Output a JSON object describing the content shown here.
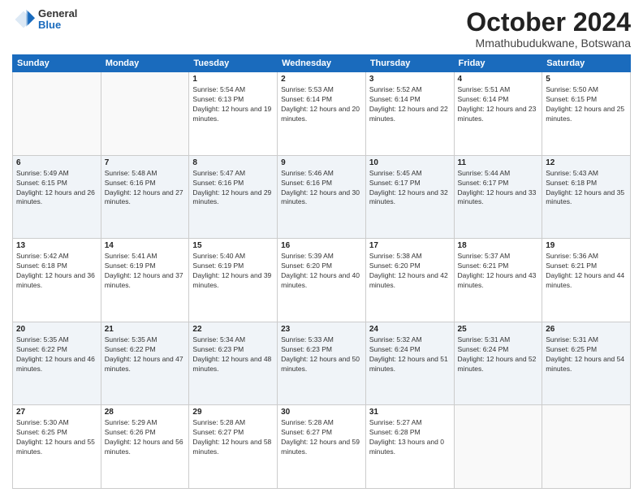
{
  "logo": {
    "general": "General",
    "blue": "Blue"
  },
  "header": {
    "month": "October 2024",
    "location": "Mmathubudukwane, Botswana"
  },
  "weekdays": [
    "Sunday",
    "Monday",
    "Tuesday",
    "Wednesday",
    "Thursday",
    "Friday",
    "Saturday"
  ],
  "weeks": [
    [
      {
        "day": "",
        "sunrise": "",
        "sunset": "",
        "daylight": ""
      },
      {
        "day": "",
        "sunrise": "",
        "sunset": "",
        "daylight": ""
      },
      {
        "day": "1",
        "sunrise": "Sunrise: 5:54 AM",
        "sunset": "Sunset: 6:13 PM",
        "daylight": "Daylight: 12 hours and 19 minutes."
      },
      {
        "day": "2",
        "sunrise": "Sunrise: 5:53 AM",
        "sunset": "Sunset: 6:14 PM",
        "daylight": "Daylight: 12 hours and 20 minutes."
      },
      {
        "day": "3",
        "sunrise": "Sunrise: 5:52 AM",
        "sunset": "Sunset: 6:14 PM",
        "daylight": "Daylight: 12 hours and 22 minutes."
      },
      {
        "day": "4",
        "sunrise": "Sunrise: 5:51 AM",
        "sunset": "Sunset: 6:14 PM",
        "daylight": "Daylight: 12 hours and 23 minutes."
      },
      {
        "day": "5",
        "sunrise": "Sunrise: 5:50 AM",
        "sunset": "Sunset: 6:15 PM",
        "daylight": "Daylight: 12 hours and 25 minutes."
      }
    ],
    [
      {
        "day": "6",
        "sunrise": "Sunrise: 5:49 AM",
        "sunset": "Sunset: 6:15 PM",
        "daylight": "Daylight: 12 hours and 26 minutes."
      },
      {
        "day": "7",
        "sunrise": "Sunrise: 5:48 AM",
        "sunset": "Sunset: 6:16 PM",
        "daylight": "Daylight: 12 hours and 27 minutes."
      },
      {
        "day": "8",
        "sunrise": "Sunrise: 5:47 AM",
        "sunset": "Sunset: 6:16 PM",
        "daylight": "Daylight: 12 hours and 29 minutes."
      },
      {
        "day": "9",
        "sunrise": "Sunrise: 5:46 AM",
        "sunset": "Sunset: 6:16 PM",
        "daylight": "Daylight: 12 hours and 30 minutes."
      },
      {
        "day": "10",
        "sunrise": "Sunrise: 5:45 AM",
        "sunset": "Sunset: 6:17 PM",
        "daylight": "Daylight: 12 hours and 32 minutes."
      },
      {
        "day": "11",
        "sunrise": "Sunrise: 5:44 AM",
        "sunset": "Sunset: 6:17 PM",
        "daylight": "Daylight: 12 hours and 33 minutes."
      },
      {
        "day": "12",
        "sunrise": "Sunrise: 5:43 AM",
        "sunset": "Sunset: 6:18 PM",
        "daylight": "Daylight: 12 hours and 35 minutes."
      }
    ],
    [
      {
        "day": "13",
        "sunrise": "Sunrise: 5:42 AM",
        "sunset": "Sunset: 6:18 PM",
        "daylight": "Daylight: 12 hours and 36 minutes."
      },
      {
        "day": "14",
        "sunrise": "Sunrise: 5:41 AM",
        "sunset": "Sunset: 6:19 PM",
        "daylight": "Daylight: 12 hours and 37 minutes."
      },
      {
        "day": "15",
        "sunrise": "Sunrise: 5:40 AM",
        "sunset": "Sunset: 6:19 PM",
        "daylight": "Daylight: 12 hours and 39 minutes."
      },
      {
        "day": "16",
        "sunrise": "Sunrise: 5:39 AM",
        "sunset": "Sunset: 6:20 PM",
        "daylight": "Daylight: 12 hours and 40 minutes."
      },
      {
        "day": "17",
        "sunrise": "Sunrise: 5:38 AM",
        "sunset": "Sunset: 6:20 PM",
        "daylight": "Daylight: 12 hours and 42 minutes."
      },
      {
        "day": "18",
        "sunrise": "Sunrise: 5:37 AM",
        "sunset": "Sunset: 6:21 PM",
        "daylight": "Daylight: 12 hours and 43 minutes."
      },
      {
        "day": "19",
        "sunrise": "Sunrise: 5:36 AM",
        "sunset": "Sunset: 6:21 PM",
        "daylight": "Daylight: 12 hours and 44 minutes."
      }
    ],
    [
      {
        "day": "20",
        "sunrise": "Sunrise: 5:35 AM",
        "sunset": "Sunset: 6:22 PM",
        "daylight": "Daylight: 12 hours and 46 minutes."
      },
      {
        "day": "21",
        "sunrise": "Sunrise: 5:35 AM",
        "sunset": "Sunset: 6:22 PM",
        "daylight": "Daylight: 12 hours and 47 minutes."
      },
      {
        "day": "22",
        "sunrise": "Sunrise: 5:34 AM",
        "sunset": "Sunset: 6:23 PM",
        "daylight": "Daylight: 12 hours and 48 minutes."
      },
      {
        "day": "23",
        "sunrise": "Sunrise: 5:33 AM",
        "sunset": "Sunset: 6:23 PM",
        "daylight": "Daylight: 12 hours and 50 minutes."
      },
      {
        "day": "24",
        "sunrise": "Sunrise: 5:32 AM",
        "sunset": "Sunset: 6:24 PM",
        "daylight": "Daylight: 12 hours and 51 minutes."
      },
      {
        "day": "25",
        "sunrise": "Sunrise: 5:31 AM",
        "sunset": "Sunset: 6:24 PM",
        "daylight": "Daylight: 12 hours and 52 minutes."
      },
      {
        "day": "26",
        "sunrise": "Sunrise: 5:31 AM",
        "sunset": "Sunset: 6:25 PM",
        "daylight": "Daylight: 12 hours and 54 minutes."
      }
    ],
    [
      {
        "day": "27",
        "sunrise": "Sunrise: 5:30 AM",
        "sunset": "Sunset: 6:25 PM",
        "daylight": "Daylight: 12 hours and 55 minutes."
      },
      {
        "day": "28",
        "sunrise": "Sunrise: 5:29 AM",
        "sunset": "Sunset: 6:26 PM",
        "daylight": "Daylight: 12 hours and 56 minutes."
      },
      {
        "day": "29",
        "sunrise": "Sunrise: 5:28 AM",
        "sunset": "Sunset: 6:27 PM",
        "daylight": "Daylight: 12 hours and 58 minutes."
      },
      {
        "day": "30",
        "sunrise": "Sunrise: 5:28 AM",
        "sunset": "Sunset: 6:27 PM",
        "daylight": "Daylight: 12 hours and 59 minutes."
      },
      {
        "day": "31",
        "sunrise": "Sunrise: 5:27 AM",
        "sunset": "Sunset: 6:28 PM",
        "daylight": "Daylight: 13 hours and 0 minutes."
      },
      {
        "day": "",
        "sunrise": "",
        "sunset": "",
        "daylight": ""
      },
      {
        "day": "",
        "sunrise": "",
        "sunset": "",
        "daylight": ""
      }
    ]
  ]
}
